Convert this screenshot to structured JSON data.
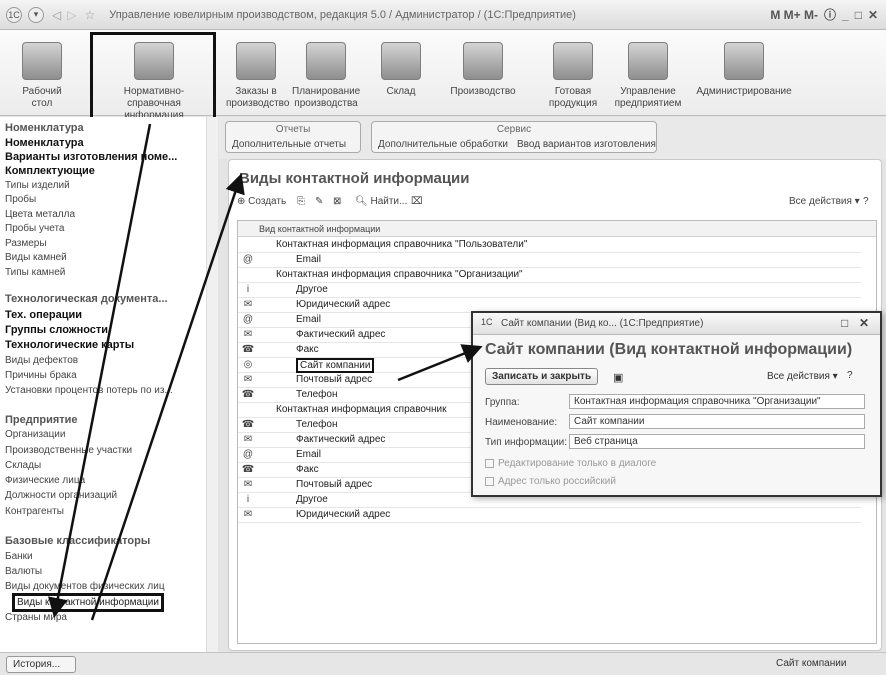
{
  "titlebar": {
    "title": "Управление ювелирным производством, редакция 5.0 / Администратор / (1С:Предприятие)",
    "right": "M M+ M-"
  },
  "sections": [
    {
      "label": "Рабочий стол",
      "icon": "desk-lamp-icon"
    },
    {
      "label": "Нормативно-справочная информация",
      "icon": "binders-icon"
    },
    {
      "label": "Заказы в производство",
      "icon": "fax-icon"
    },
    {
      "label": "Планирование производства",
      "icon": "book-icon"
    },
    {
      "label": "Склад",
      "icon": "box-icon"
    },
    {
      "label": "Производство",
      "icon": "spool-icon"
    },
    {
      "label": "Готовая продукция",
      "icon": "ring-icon"
    },
    {
      "label": "Управление предприятием",
      "icon": "chart-icon"
    },
    {
      "label": "Администрирование",
      "icon": "server-icon"
    }
  ],
  "nav": [
    {
      "t": "Номенклатура",
      "c": "grp"
    },
    {
      "t": "Номенклатура",
      "c": "bold"
    },
    {
      "t": "Варианты изготовления номе...",
      "c": "bold"
    },
    {
      "t": "Комплектующие",
      "c": "bold"
    },
    {
      "t": "Типы изделий",
      "c": ""
    },
    {
      "t": "Пробы",
      "c": ""
    },
    {
      "t": "Цвета металла",
      "c": ""
    },
    {
      "t": "Пробы учета",
      "c": ""
    },
    {
      "t": "Размеры",
      "c": ""
    },
    {
      "t": "Виды камней",
      "c": ""
    },
    {
      "t": "Типы камней",
      "c": ""
    },
    {
      "t": "Технологическая документа...",
      "c": "grp"
    },
    {
      "t": "Тех. операции",
      "c": "bold"
    },
    {
      "t": "Группы сложности",
      "c": "bold"
    },
    {
      "t": "Технологические карты",
      "c": "bold"
    },
    {
      "t": "Виды дефектов",
      "c": ""
    },
    {
      "t": "Причины брака",
      "c": ""
    },
    {
      "t": "Установки процентов потерь по из...",
      "c": ""
    },
    {
      "t": "Предприятие",
      "c": "grp"
    },
    {
      "t": "Организации",
      "c": ""
    },
    {
      "t": "Производственные участки",
      "c": ""
    },
    {
      "t": "Склады",
      "c": ""
    },
    {
      "t": "Физические лица",
      "c": ""
    },
    {
      "t": "Должности организаций",
      "c": ""
    },
    {
      "t": "Контрагенты",
      "c": ""
    },
    {
      "t": "Базовые классификаторы",
      "c": "grp"
    },
    {
      "t": "Банки",
      "c": ""
    },
    {
      "t": "Валюты",
      "c": ""
    },
    {
      "t": "Виды документов физических лиц",
      "c": ""
    },
    {
      "t": "Виды контактной информации",
      "c": "sel"
    },
    {
      "t": "Страны мира",
      "c": ""
    }
  ],
  "cmd": {
    "reports_hd": "Отчеты",
    "reports": "Дополнительные отчеты",
    "service_hd": "Сервис",
    "proc": "Дополнительные обработки",
    "variants": "Ввод вариантов изготовления"
  },
  "page": {
    "title": "Виды контактной информации",
    "create": "Создать",
    "find": "Найти...",
    "all": "Все действия ▾",
    "col": "Вид контактной информации"
  },
  "rows": [
    {
      "t": "Контактная информация справочника \"Пользователи\"",
      "g": true,
      "i": ""
    },
    {
      "t": "Email",
      "g": false,
      "i": "@"
    },
    {
      "t": "Контактная информация справочника \"Организации\"",
      "g": true,
      "i": ""
    },
    {
      "t": "Другое",
      "g": false,
      "i": "i"
    },
    {
      "t": "Юридический адрес",
      "g": false,
      "i": "✉"
    },
    {
      "t": "Email",
      "g": false,
      "i": "@"
    },
    {
      "t": "Фактический адрес",
      "g": false,
      "i": "✉"
    },
    {
      "t": "Факс",
      "g": false,
      "i": "☎"
    },
    {
      "t": "Сайт компании",
      "g": false,
      "i": "◎",
      "sel": true
    },
    {
      "t": "Почтовый адрес",
      "g": false,
      "i": "✉"
    },
    {
      "t": "Телефон",
      "g": false,
      "i": "☎"
    },
    {
      "t": "Контактная информация справочник",
      "g": true,
      "i": ""
    },
    {
      "t": "Телефон",
      "g": false,
      "i": "☎"
    },
    {
      "t": "Фактический адрес",
      "g": false,
      "i": "✉"
    },
    {
      "t": "Email",
      "g": false,
      "i": "@"
    },
    {
      "t": "Факс",
      "g": false,
      "i": "☎"
    },
    {
      "t": "Почтовый адрес",
      "g": false,
      "i": "✉"
    },
    {
      "t": "Другое",
      "g": false,
      "i": "i"
    },
    {
      "t": "Юридический адрес",
      "g": false,
      "i": "✉"
    }
  ],
  "dialog": {
    "title": "Сайт компании (Вид ко... (1С:Предприятие)",
    "heading": "Сайт компании (Вид контактной информации)",
    "save": "Записать и закрыть",
    "all": "Все действия ▾",
    "group_lbl": "Группа:",
    "group_val": "Контактная информация справочника \"Организации\"",
    "name_lbl": "Наименование:",
    "name_val": "Сайт компании",
    "type_lbl": "Тип информации:",
    "type_val": "Веб страница",
    "chk1": "Редактирование только в диалоге",
    "chk2": "Адрес только российский"
  },
  "status": {
    "history": "История...",
    "right": "Сайт компании"
  }
}
